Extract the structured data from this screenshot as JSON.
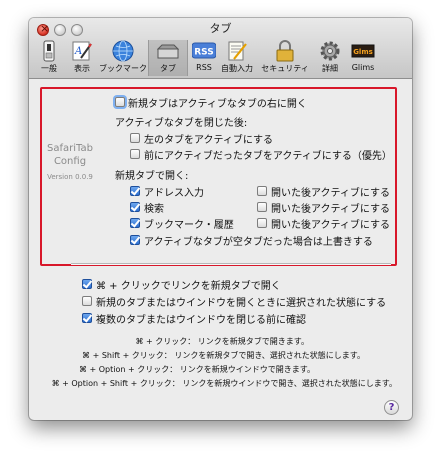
{
  "window": {
    "title": "タブ"
  },
  "toolbar": {
    "items": [
      {
        "label": "一般",
        "icon": "switch-icon"
      },
      {
        "label": "表示",
        "icon": "appearance-icon"
      },
      {
        "label": "ブックマーク",
        "icon": "globe-icon"
      },
      {
        "label": "タブ",
        "icon": "tabs-icon",
        "selected": true
      },
      {
        "label": "RSS",
        "icon": "rss-icon"
      },
      {
        "label": "自動入力",
        "icon": "autofill-icon"
      },
      {
        "label": "セキュリティ",
        "icon": "lock-icon"
      },
      {
        "label": "詳細",
        "icon": "gear-icon"
      },
      {
        "label": "Glims",
        "icon": "glims-icon"
      }
    ]
  },
  "plugin": {
    "brand_line1": "SafariTab",
    "brand_line2": "Config",
    "version": "Version 0.0.9",
    "open_right": {
      "label": "新規タブはアクティブなタブの右に開く",
      "checked": false
    },
    "after_close_heading": "アクティブなタブを閉じた後:",
    "activate_left": {
      "label": "左のタブをアクティブにする",
      "checked": false
    },
    "activate_previous": {
      "label": "前にアクティブだったタブをアクティブにする（優先）",
      "checked": false
    },
    "new_tab_heading": "新規タブで開く:",
    "address": {
      "label": "アドレス入力",
      "checked": true
    },
    "address_activate": {
      "label": "開いた後アクティブにする",
      "checked": false
    },
    "search": {
      "label": "検索",
      "checked": true
    },
    "search_activate": {
      "label": "開いた後アクティブにする",
      "checked": false
    },
    "bookmarks": {
      "label": "ブックマーク・履歴",
      "checked": true
    },
    "bookmarks_activate": {
      "label": "開いた後アクティブにする",
      "checked": false
    },
    "overwrite_empty": {
      "label": "アクティブなタブが空タブだった場合は上書きする",
      "checked": true
    }
  },
  "safari": {
    "cmd_click": {
      "label": "⌘ + クリックでリンクを新規タブで開く",
      "checked": true
    },
    "select_new": {
      "label": "新規のタブまたはウインドウを開くときに選択された状態にする",
      "checked": false
    },
    "confirm_close": {
      "label": "複数のタブまたはウインドウを閉じる前に確認",
      "checked": true
    },
    "shortcuts": [
      "⌘ + クリック： リンクを新規タブで開きます。",
      "⌘ + Shift + クリック： リンクを新規タブで開き、選択された状態にします。",
      "⌘ + Option + クリック： リンクを新規ウインドウで開きます。",
      "⌘ + Option + Shift + クリック： リンクを新規ウインドウで開き、選択された状態にします。"
    ]
  },
  "help": "?"
}
